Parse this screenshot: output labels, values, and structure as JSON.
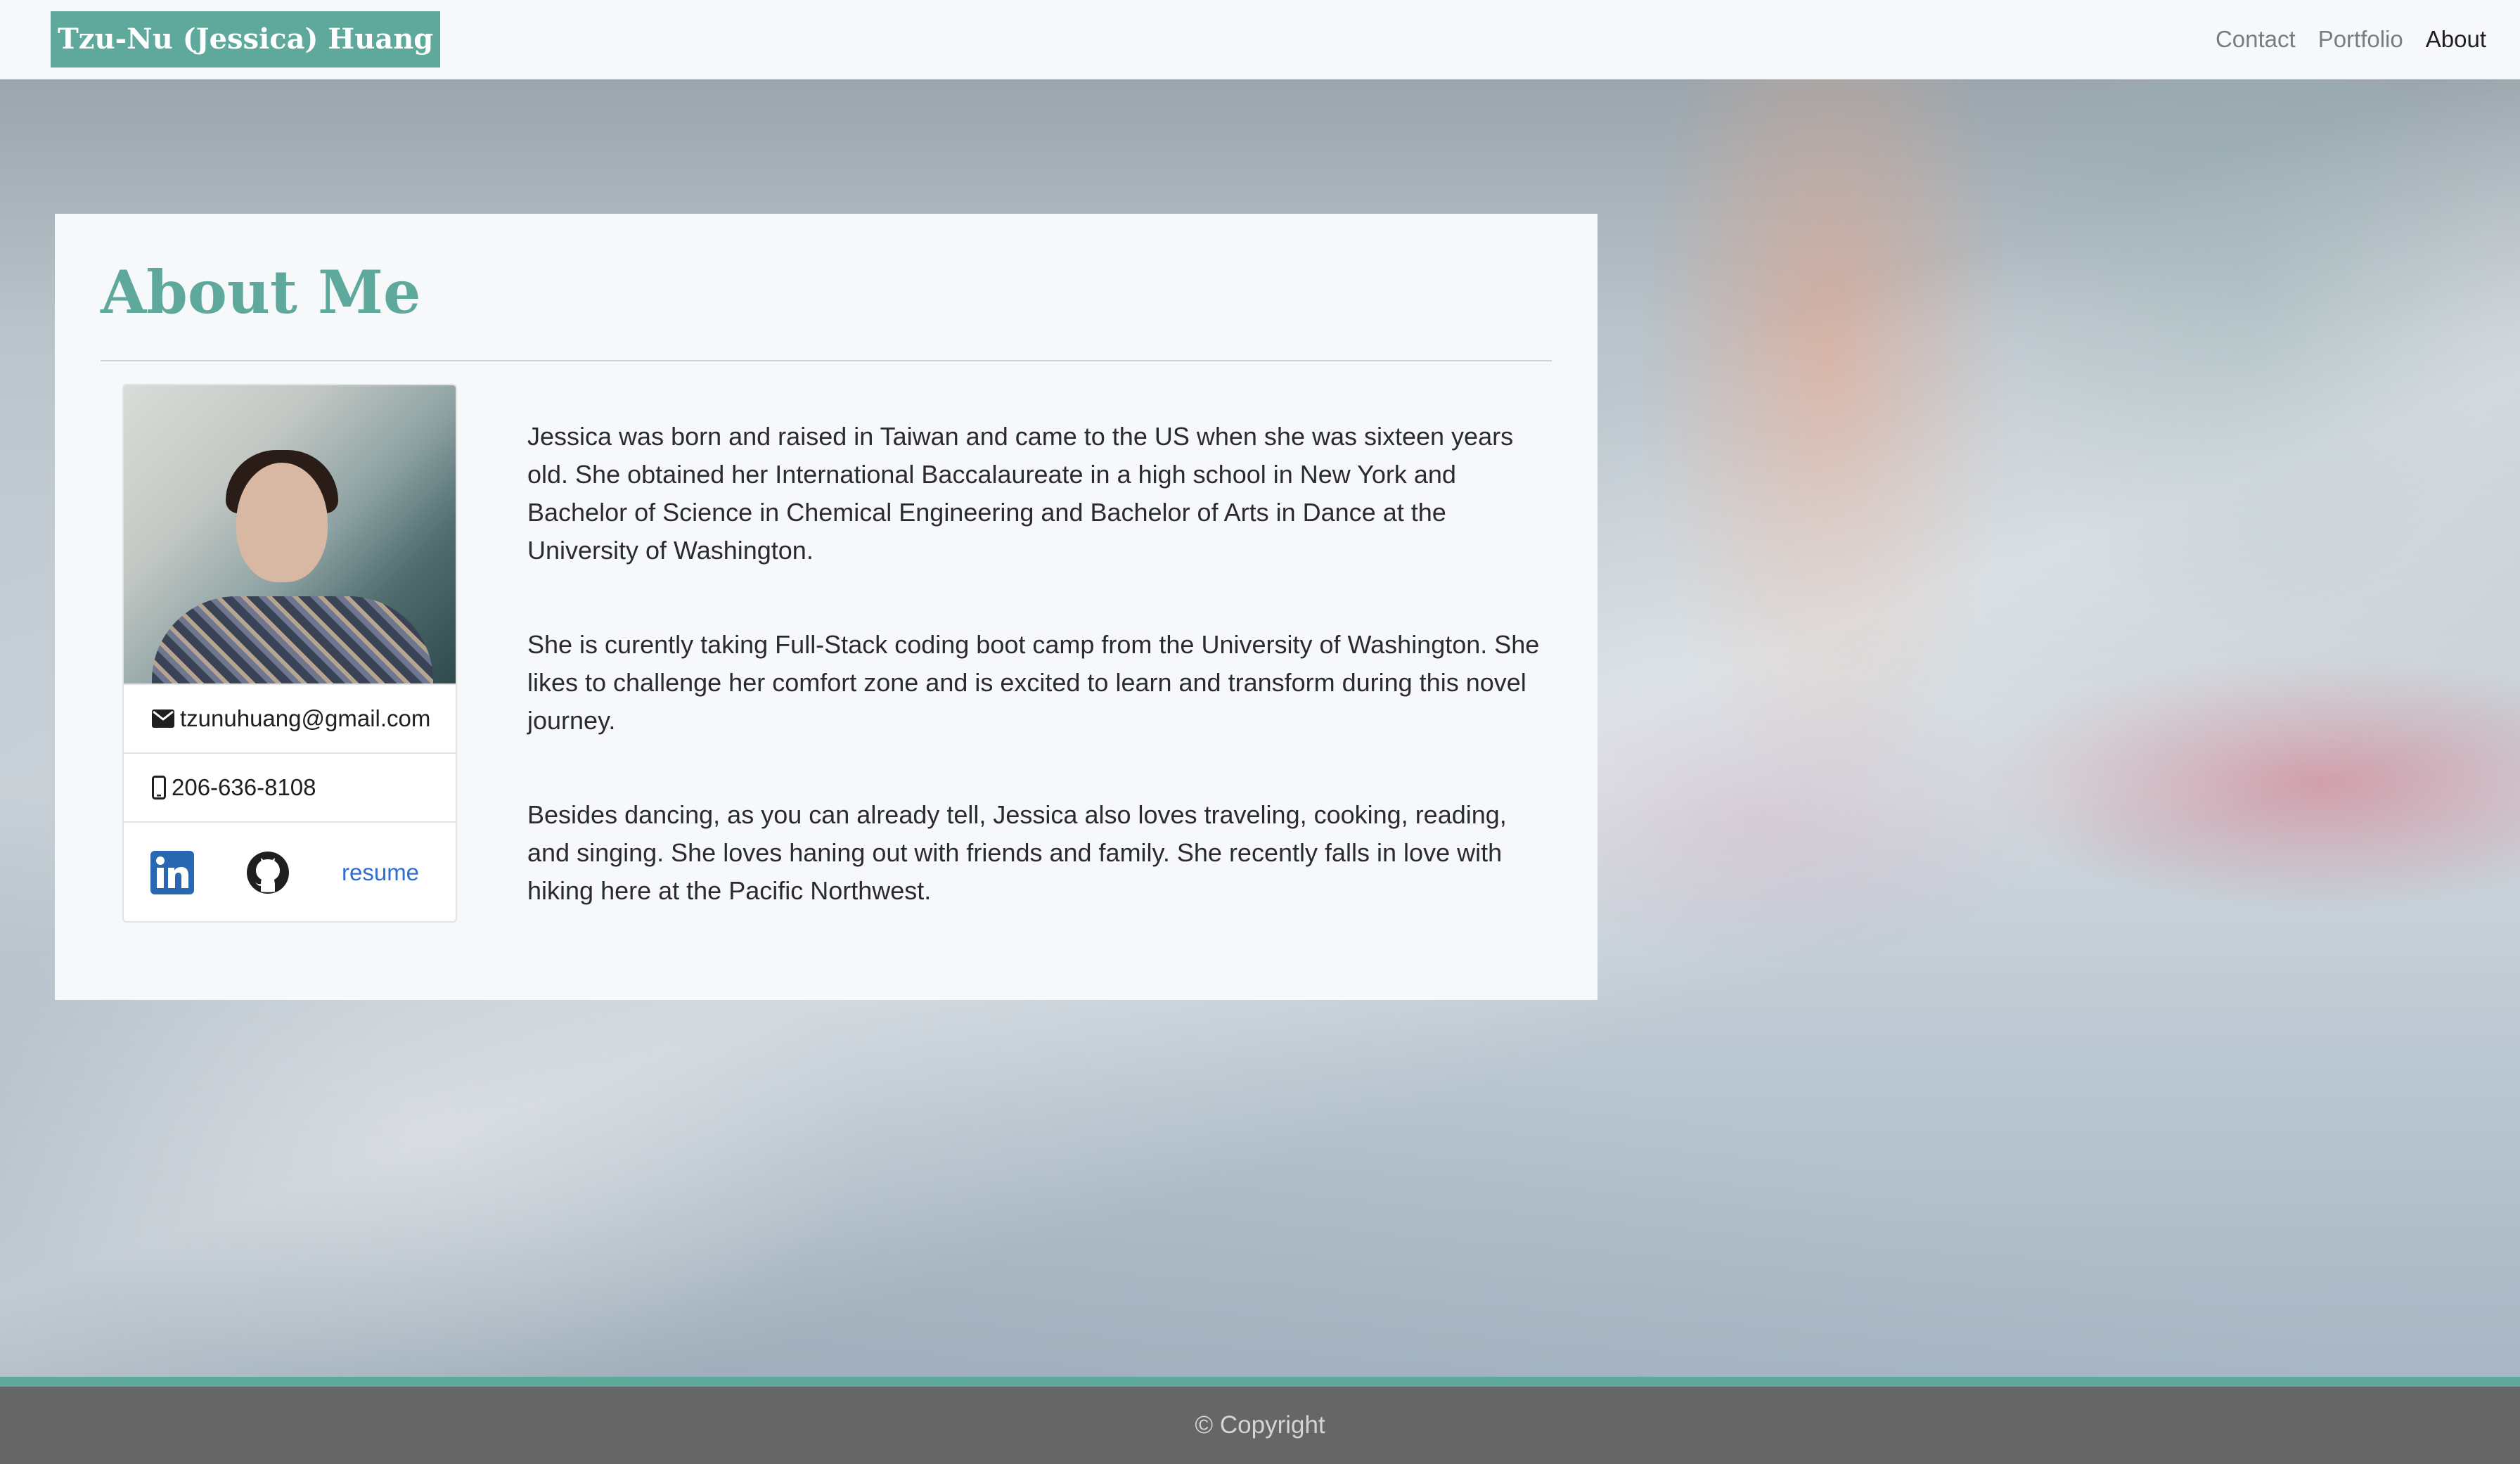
{
  "navbar": {
    "brand": "Tzu-Nu (Jessica) Huang",
    "links": [
      {
        "label": "Contact",
        "active": false
      },
      {
        "label": "Portfolio",
        "active": false
      },
      {
        "label": "About",
        "active": true
      }
    ]
  },
  "about": {
    "title": "About Me",
    "profile": {
      "photo_alt": "portrait photo",
      "email": "tzunuhuang@gmail.com",
      "email_icon": "envelope-icon",
      "phone": "206-636-8108",
      "phone_icon": "mobile-phone-icon",
      "links": {
        "linkedin_icon": "linkedin-icon",
        "github_icon": "github-icon",
        "resume_label": "resume"
      }
    },
    "paragraphs": [
      "Jessica was born and raised in Taiwan and came to the US when she was sixteen years old. She obtained her International Baccalaureate in a high school in New York and Bachelor of Science in Chemical Engineering and Bachelor of Arts in Dance at the University of Washington.",
      "She is curently taking Full-Stack coding boot camp from the University of Washington. She likes to challenge her comfort zone and is excited to learn and transform during this novel journey.",
      "Besides dancing, as you can already tell, Jessica also loves traveling, cooking, reading, and singing. She loves haning out with friends and family. She recently falls in love with hiking here at the Pacific Northwest."
    ]
  },
  "footer": {
    "copyright": "© Copyright"
  },
  "colors": {
    "accent": "#5ea89c",
    "footer_bg": "#666666",
    "link": "#2f6fd1",
    "linkedin": "#2867b2"
  }
}
